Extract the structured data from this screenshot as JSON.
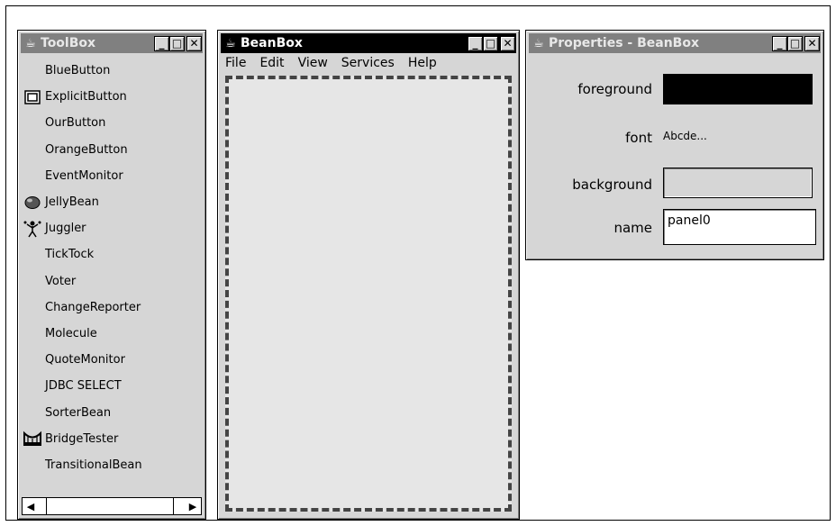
{
  "toolbox": {
    "title": "ToolBox",
    "items": [
      {
        "label": "BlueButton",
        "icon": null
      },
      {
        "label": "ExplicitButton",
        "icon": "explicit-button-icon"
      },
      {
        "label": "OurButton",
        "icon": null
      },
      {
        "label": "OrangeButton",
        "icon": null
      },
      {
        "label": "EventMonitor",
        "icon": null
      },
      {
        "label": "JellyBean",
        "icon": "jellybean-icon"
      },
      {
        "label": "Juggler",
        "icon": "juggler-icon"
      },
      {
        "label": "TickTock",
        "icon": null
      },
      {
        "label": "Voter",
        "icon": null
      },
      {
        "label": "ChangeReporter",
        "icon": null
      },
      {
        "label": "Molecule",
        "icon": null
      },
      {
        "label": "QuoteMonitor",
        "icon": null
      },
      {
        "label": "JDBC SELECT",
        "icon": null
      },
      {
        "label": "SorterBean",
        "icon": null
      },
      {
        "label": "BridgeTester",
        "icon": "bridge-tester-icon"
      },
      {
        "label": "TransitionalBean",
        "icon": null
      }
    ]
  },
  "beanbox": {
    "title": "BeanBox",
    "menu": [
      "File",
      "Edit",
      "View",
      "Services",
      "Help"
    ]
  },
  "properties": {
    "title": "Properties - BeanBox",
    "foreground_label": "foreground",
    "foreground_color": "#000000",
    "font_label": "font",
    "font_value": "Abcde...",
    "background_label": "background",
    "background_color": "#d6d6d6",
    "name_label": "name",
    "name_value": "panel0"
  },
  "window_buttons": {
    "minimize": "_",
    "maximize": "□",
    "close": "✕"
  }
}
